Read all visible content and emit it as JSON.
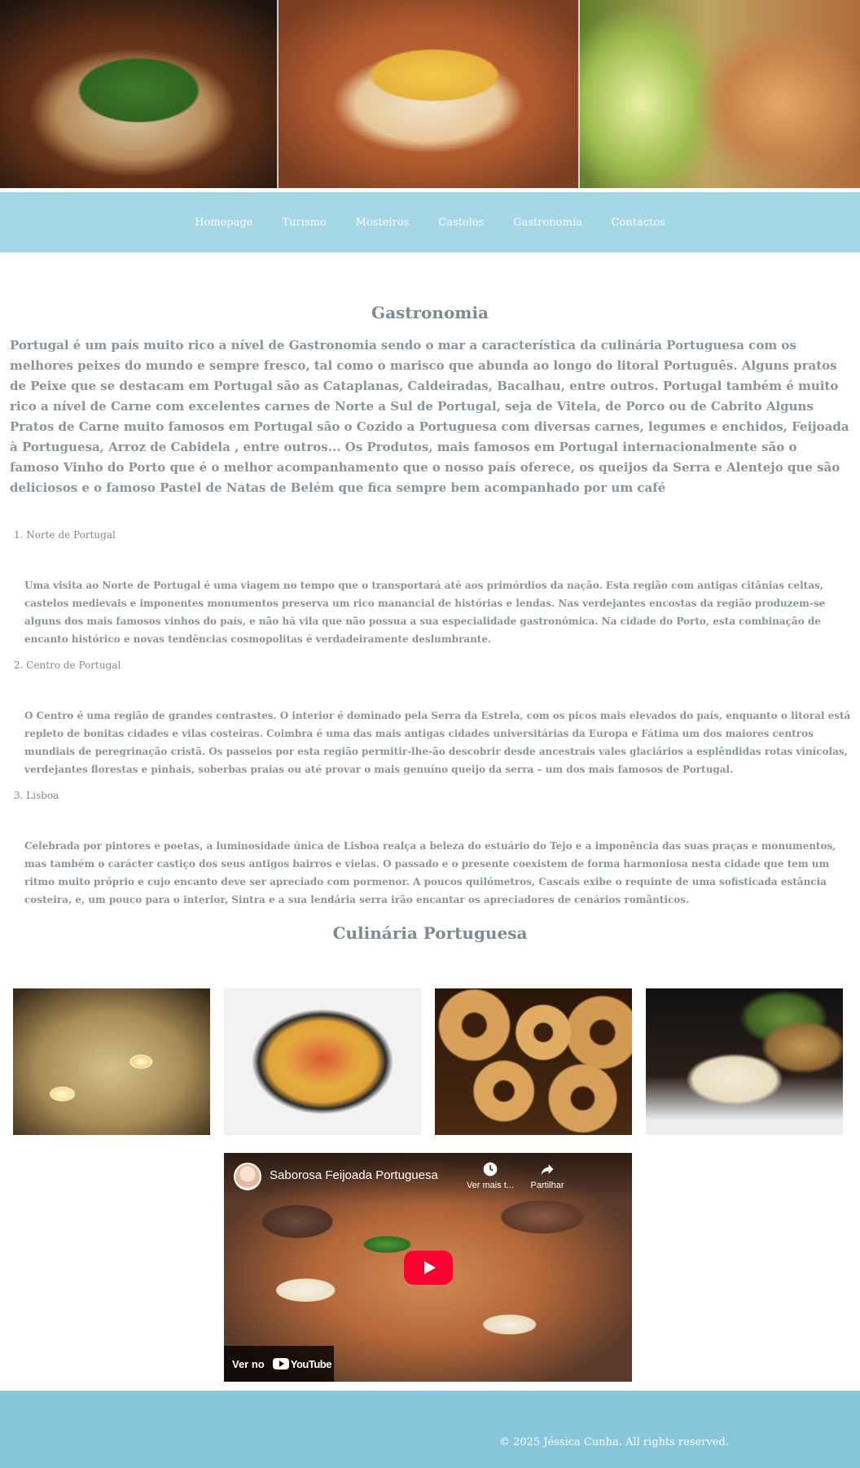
{
  "nav": {
    "items": [
      "Homepage",
      "Turismo",
      "Mosteiros",
      "Castelos",
      "Gastronomia",
      "Contactos"
    ]
  },
  "main": {
    "title": "Gastronomia",
    "intro": "Portugal é um país muito rico a nível de Gastronomia sendo o mar a característica da culinária Portuguesa com os melhores peixes do mundo e sempre fresco, tal como o marisco que abunda ao longo do litoral Português. Alguns pratos de Peixe que se destacam em Portugal são as Cataplanas, Caldeiradas, Bacalhau, entre outros. Portugal também é muito rico a nível de Carne com excelentes carnes de Norte a Sul de Portugal, seja de Vitela, de Porco ou de Cabrito Alguns Pratos de Carne muito famosos em Portugal são o Cozido a Portuguesa com diversas carnes, legumes e enchidos, Feijoada à Portuguesa, Arroz de Cabidela , entre outros... Os Produtos, mais famosos em Portugal internacionalmente são o famoso Vinho do Porto que é o melhor acompanhamento que o nosso país oferece, os queijos da Serra e Alentejo que são deliciosos e o famoso Pastel de Natas de Belém que fica sempre bem acompanhado por um café",
    "regions": [
      {
        "title": "1. Norte de Portugal",
        "text": "Uma visita ao Norte de Portugal é uma viagem no tempo que o transportará até aos primórdios da nação. Esta região com antigas citânias celtas, castelos medievais e imponentes monumentos preserva um rico manancial de histórias e lendas. Nas verdejantes encostas da região produzem-se alguns dos mais famosos vinhos do país, e não há vila que não possua a sua especialidade gastronómica. Na cidade do Porto, esta combinação de encanto histórico e novas tendências cosmopolitas é verdadeiramente deslumbrante."
      },
      {
        "title": "2. Centro de Portugal",
        "text": "O Centro é uma região de grandes contrastes. O interior é dominado pela Serra da Estrela, com os picos mais elevados do país, enquanto o litoral está repleto de bonitas cidades e vilas costeiras. Coimbra é uma das mais antigas cidades universitárias da Europa e Fátima um dos maiores centros mundiais de peregrinação cristã. Os passeios por esta região permitir-lhe-ão descobrir desde ancestrais vales glaciários a esplêndidas rotas vinícolas, verdejantes florestas e pinhais, soberbas praias ou até provar o mais genuíno queijo da serra – um dos mais famosos de Portugal."
      },
      {
        "title": "3. Lisboa",
        "text": "Celebrada por pintores e poetas, a luminosidade única de Lisboa realça a beleza do estuário do Tejo e a imponência das suas praças e monumentos, mas também o carácter  castiço dos seus antigos bairros e vielas. O passado e o presente coexistem de forma harmoniosa nesta cidade que tem um ritmo muito próprio e cujo encanto deve ser apreciado com pormenor. A poucos quilómetros, Cascais exibe o requinte de uma sofisticada estância costeira, e, um pouco para o interior, Sintra e a sua lendária serra irão encantar os apreciadores de cenários românticos."
      }
    ],
    "culinaria_title": "Culinária Portuguesa"
  },
  "video": {
    "title": "Saborosa Feijoada Portuguesa",
    "watch_later": "Ver mais t...",
    "share": "Partilhar",
    "watch_on": "Ver no",
    "youtube": "YouTube"
  },
  "footer": {
    "text": "© 2025 Jéssica Cunha. All rights reserved."
  },
  "colors": {
    "nav_bg": "#a6d7e7",
    "footer_bg": "#88c6d9",
    "text": "#8b9499",
    "play_red": "#ff0033"
  }
}
